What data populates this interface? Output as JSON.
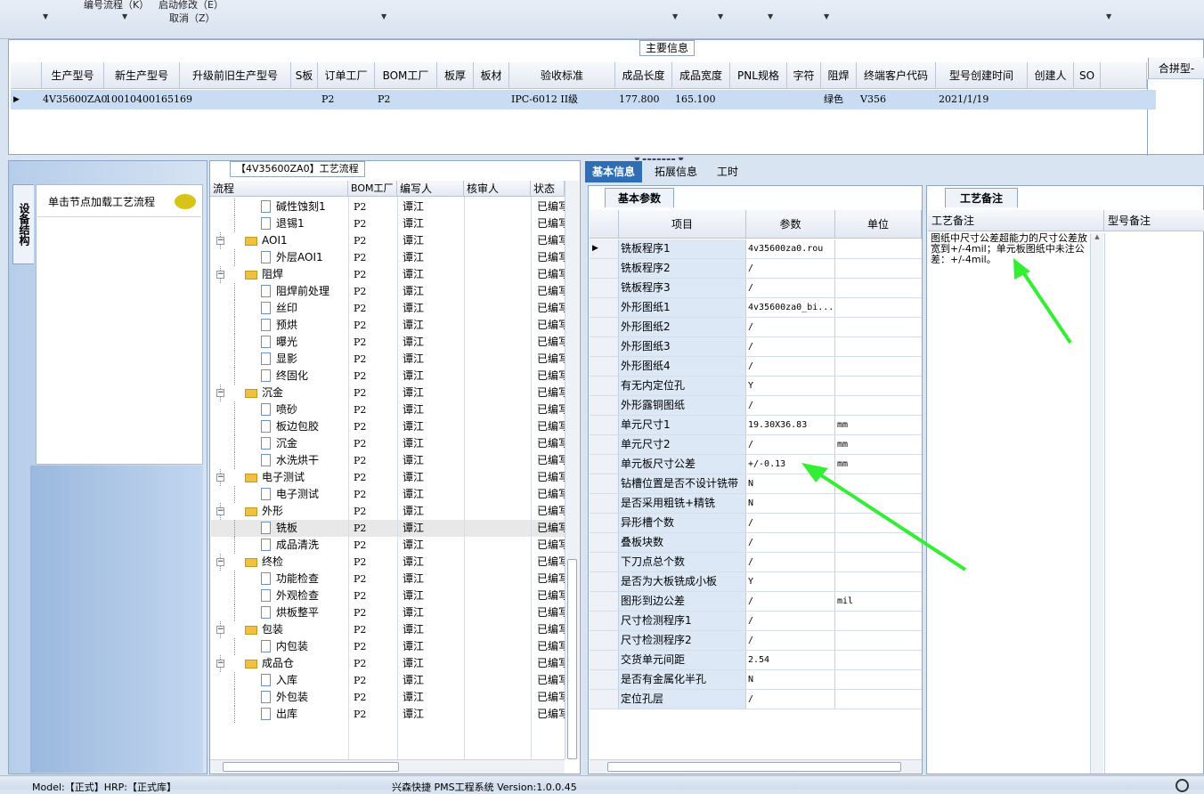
{
  "toolbar": {
    "menu_items": [
      "编号流程（K）",
      "启动修改（E）",
      "取消（Z）"
    ]
  },
  "top_panel": {
    "legend": "主要信息",
    "right_header": "合拼型-",
    "columns": [
      "生产型号",
      "新生产型号",
      "升级前旧生产型号",
      "S板",
      "订单工厂",
      "BOM工厂",
      "板厚",
      "板材",
      "验收标准",
      "成品长度",
      "成品宽度",
      "PNL规格",
      "字符",
      "阻焊",
      "终端客户代码",
      "型号创建时间",
      "创建人",
      "SO"
    ],
    "row": {
      "model": "4V35600ZA0",
      "new_model": "10010400165169",
      "order_factory": "P2",
      "bom_factory": "P2",
      "standard": "IPC-6012 II级",
      "length": "177.800",
      "width": "165.100",
      "solder_mask": "绿色",
      "customer_code": "V356",
      "created": "2021/1/19"
    }
  },
  "left_nav": {
    "vertical_tab": "设备结构",
    "load_button": "单击节点加载工艺流程"
  },
  "tree_panel": {
    "legend": "【4V35600ZA0】工艺流程",
    "columns": [
      "流程",
      "BOM工厂",
      "编写人",
      "核审人",
      "状态"
    ],
    "rows": [
      {
        "name": "碱性蚀刻1",
        "type": "doc",
        "level": 2,
        "bom": "P2",
        "writer": "谭江",
        "status": "已编写"
      },
      {
        "name": "退锡1",
        "type": "doc",
        "level": 2,
        "bom": "P2",
        "writer": "谭江",
        "status": "已编写"
      },
      {
        "name": "AOI1",
        "type": "folder",
        "level": 1,
        "bom": "P2",
        "writer": "谭江",
        "status": "已编写"
      },
      {
        "name": "外层AOI1",
        "type": "doc",
        "level": 2,
        "bom": "P2",
        "writer": "谭江",
        "status": "已编写"
      },
      {
        "name": "阻焊",
        "type": "folder",
        "level": 1,
        "bom": "P2",
        "writer": "谭江",
        "status": "已编写"
      },
      {
        "name": "阻焊前处理",
        "type": "doc",
        "level": 2,
        "bom": "P2",
        "writer": "谭江",
        "status": "已编写"
      },
      {
        "name": "丝印",
        "type": "doc",
        "level": 2,
        "bom": "P2",
        "writer": "谭江",
        "status": "已编写"
      },
      {
        "name": "预烘",
        "type": "doc",
        "level": 2,
        "bom": "P2",
        "writer": "谭江",
        "status": "已编写"
      },
      {
        "name": "曝光",
        "type": "doc",
        "level": 2,
        "bom": "P2",
        "writer": "谭江",
        "status": "已编写"
      },
      {
        "name": "显影",
        "type": "doc",
        "level": 2,
        "bom": "P2",
        "writer": "谭江",
        "status": "已编写"
      },
      {
        "name": "终固化",
        "type": "doc",
        "level": 2,
        "bom": "P2",
        "writer": "谭江",
        "status": "已编写"
      },
      {
        "name": "沉金",
        "type": "folder",
        "level": 1,
        "bom": "P2",
        "writer": "谭江",
        "status": "已编写"
      },
      {
        "name": "喷砂",
        "type": "doc",
        "level": 2,
        "bom": "P2",
        "writer": "谭江",
        "status": "已编写"
      },
      {
        "name": "板边包胶",
        "type": "doc",
        "level": 2,
        "bom": "P2",
        "writer": "谭江",
        "status": "已编写"
      },
      {
        "name": "沉金",
        "type": "doc",
        "level": 2,
        "bom": "P2",
        "writer": "谭江",
        "status": "已编写"
      },
      {
        "name": "水洗烘干",
        "type": "doc",
        "level": 2,
        "bom": "P2",
        "writer": "谭江",
        "status": "已编写"
      },
      {
        "name": "电子测试",
        "type": "folder",
        "level": 1,
        "bom": "P2",
        "writer": "谭江",
        "status": "已编写"
      },
      {
        "name": "电子测试",
        "type": "doc",
        "level": 2,
        "bom": "P2",
        "writer": "谭江",
        "status": "已编写"
      },
      {
        "name": "外形",
        "type": "folder",
        "level": 1,
        "bom": "P2",
        "writer": "谭江",
        "status": "已编写"
      },
      {
        "name": "铣板",
        "type": "doc",
        "level": 2,
        "bom": "P2",
        "writer": "谭江",
        "status": "已编写"
      },
      {
        "name": "成品清洗",
        "type": "doc",
        "level": 2,
        "bom": "P2",
        "writer": "谭江",
        "status": "已编写"
      },
      {
        "name": "终检",
        "type": "folder",
        "level": 1,
        "bom": "P2",
        "writer": "谭江",
        "status": "已编写"
      },
      {
        "name": "功能检查",
        "type": "doc",
        "level": 2,
        "bom": "P2",
        "writer": "谭江",
        "status": "已编写"
      },
      {
        "name": "外观检查",
        "type": "doc",
        "level": 2,
        "bom": "P2",
        "writer": "谭江",
        "status": "已编写"
      },
      {
        "name": "烘板整平",
        "type": "doc",
        "level": 2,
        "bom": "P2",
        "writer": "谭江",
        "status": "已编写"
      },
      {
        "name": "包装",
        "type": "folder",
        "level": 1,
        "bom": "P2",
        "writer": "谭江",
        "status": "已编写"
      },
      {
        "name": "内包装",
        "type": "doc",
        "level": 2,
        "bom": "P2",
        "writer": "谭江",
        "status": "已编写"
      },
      {
        "name": "成品仓",
        "type": "folder",
        "level": 1,
        "bom": "P2",
        "writer": "谭江",
        "status": "已编写"
      },
      {
        "name": "入库",
        "type": "doc",
        "level": 2,
        "bom": "P2",
        "writer": "谭江",
        "status": "已编写"
      },
      {
        "name": "外包装",
        "type": "doc",
        "level": 2,
        "bom": "P2",
        "writer": "谭江",
        "status": "已编写"
      },
      {
        "name": "出库",
        "type": "doc",
        "level": 2,
        "bom": "P2",
        "writer": "谭江",
        "status": "已编写"
      }
    ]
  },
  "right_tabs": [
    "基本信息",
    "拓展信息",
    "工时"
  ],
  "basic_params": {
    "title": "基本参数",
    "columns": [
      "项目",
      "参数",
      "单位"
    ],
    "rows": [
      {
        "item": "铣板程序1",
        "value": "4v35600za0.rou",
        "unit": ""
      },
      {
        "item": "铣板程序2",
        "value": "/",
        "unit": ""
      },
      {
        "item": "铣板程序3",
        "value": "/",
        "unit": ""
      },
      {
        "item": "外形图纸1",
        "value": "4v35600za0_bi...",
        "unit": ""
      },
      {
        "item": "外形图纸2",
        "value": "/",
        "unit": ""
      },
      {
        "item": "外形图纸3",
        "value": "/",
        "unit": ""
      },
      {
        "item": "外形图纸4",
        "value": "/",
        "unit": ""
      },
      {
        "item": "有无内定位孔",
        "value": "Y",
        "unit": ""
      },
      {
        "item": "外形露铜图纸",
        "value": "/",
        "unit": ""
      },
      {
        "item": "单元尺寸1",
        "value": "19.30X36.83",
        "unit": "mm"
      },
      {
        "item": "单元尺寸2",
        "value": "/",
        "unit": "mm"
      },
      {
        "item": "单元板尺寸公差",
        "value": "+/-0.13",
        "unit": "mm"
      },
      {
        "item": "钻槽位置是否不设计铣带",
        "value": "N",
        "unit": ""
      },
      {
        "item": "是否采用粗铣+精铣",
        "value": "N",
        "unit": ""
      },
      {
        "item": "异形槽个数",
        "value": "/",
        "unit": ""
      },
      {
        "item": "叠板块数",
        "value": "/",
        "unit": ""
      },
      {
        "item": "下刀点总个数",
        "value": "/",
        "unit": ""
      },
      {
        "item": "是否为大板铣成小板",
        "value": "Y",
        "unit": ""
      },
      {
        "item": "图形到边公差",
        "value": "/",
        "unit": "mil"
      },
      {
        "item": "尺寸检测程序1",
        "value": "/",
        "unit": ""
      },
      {
        "item": "尺寸检测程序2",
        "value": "/",
        "unit": ""
      },
      {
        "item": "交货单元间距",
        "value": "2.54",
        "unit": ""
      },
      {
        "item": "是否有金属化半孔",
        "value": "N",
        "unit": ""
      },
      {
        "item": "定位孔层",
        "value": "/",
        "unit": ""
      }
    ]
  },
  "remarks": {
    "tab": "工艺备注",
    "col1": "工艺备注",
    "col2": "型号备注",
    "text": "图纸中尺寸公差超能力的尺寸公差放宽到+/-4mil；单元板图纸中未注公差：+/-4mil。"
  },
  "statusbar": {
    "left": "Model:【正式】HRP:【正式库】",
    "center": "兴森快捷 PMS工程系统 Version:1.0.0.45"
  }
}
